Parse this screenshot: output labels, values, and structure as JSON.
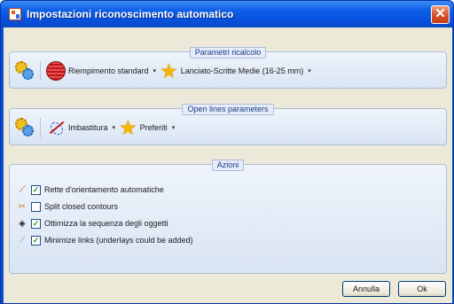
{
  "window": {
    "title": "Impostazioni riconoscimento automatico",
    "close_glyph": "✕"
  },
  "group1": {
    "label": "Parametri ricalcolo",
    "fill_button": {
      "label": "Riempimento standard",
      "icon": "fill-ball-icon"
    },
    "preset_button": {
      "label": "Lanciato-Scritte Medie (16-25 mm)",
      "icon": "star-icon"
    }
  },
  "group2": {
    "label": "Open lines parameters",
    "stitch_button": {
      "label": "Imbastitura",
      "icon": "needle-icon"
    },
    "favorites_button": {
      "label": "Preferiti",
      "icon": "star-icon"
    }
  },
  "group3": {
    "label": "Azioni",
    "items": [
      {
        "label": "Rette d'orientamento automatiche",
        "checked": true,
        "icon": "pen-line-icon"
      },
      {
        "label": "Split closed contours",
        "checked": false,
        "icon": "split-icon"
      },
      {
        "label": "Ottimizza la sequenza degli oggetti",
        "checked": true,
        "icon": "diamond-icon"
      },
      {
        "label": "Minimize links (underlays could be added)",
        "checked": true,
        "icon": "link-icon"
      }
    ]
  },
  "buttons": {
    "cancel": "Annulla",
    "ok": "Ok"
  },
  "glyphs": {
    "dropdown": "▾",
    "check": "✓",
    "star": "★"
  }
}
